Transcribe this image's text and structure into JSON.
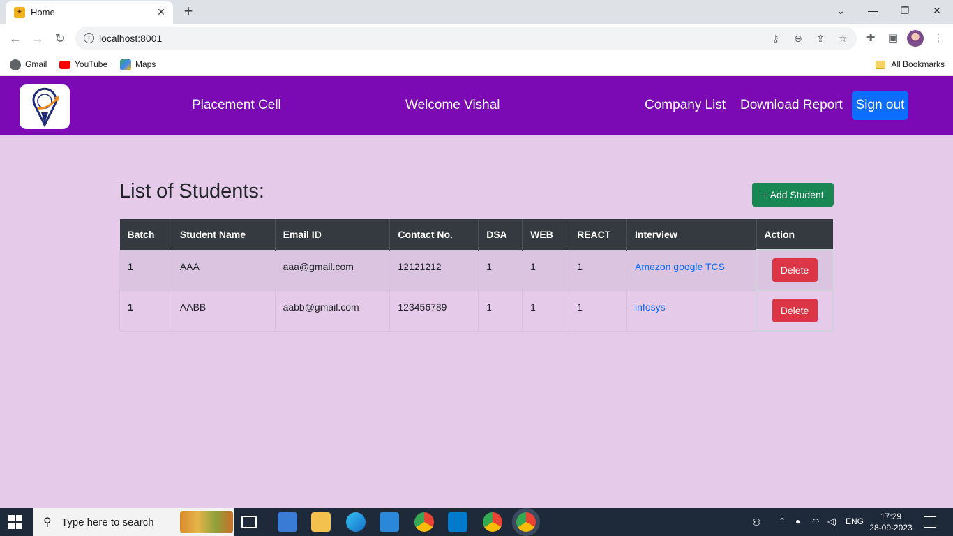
{
  "browser": {
    "tab_title": "Home",
    "tab_close": "✕",
    "new_tab": "+",
    "url": "localhost:8001",
    "bookmarks": [
      {
        "label": "Gmail",
        "icon": "gmail-icon",
        "color": "#5f6368"
      },
      {
        "label": "YouTube",
        "icon": "youtube-icon",
        "color": "#ff0000"
      },
      {
        "label": "Maps",
        "icon": "maps-icon",
        "color": "#34a853"
      }
    ],
    "all_bookmarks": "All Bookmarks"
  },
  "header": {
    "brand": "Placement Cell",
    "welcome": "Welcome Vishal",
    "company_list": "Company List",
    "download_report": "Download Report",
    "sign_out": "Sign out",
    "bg_color": "#7b0ab5"
  },
  "main": {
    "title": "List of Students:",
    "add_student": "+ Add Student",
    "columns": [
      "Batch",
      "Student Name",
      "Email ID",
      "Contact No.",
      "DSA",
      "WEB",
      "REACT",
      "Interview",
      "Action"
    ],
    "rows": [
      {
        "batch": "1",
        "name": "AAA",
        "email": "aaa@gmail.com",
        "contact": "12121212",
        "dsa": "1",
        "web": "1",
        "react": "1",
        "interview": "Amezon google TCS",
        "action": "Delete"
      },
      {
        "batch": "1",
        "name": "AABB",
        "email": "aabb@gmail.com",
        "contact": "123456789",
        "dsa": "1",
        "web": "1",
        "react": "1",
        "interview": "infosys",
        "action": "Delete"
      }
    ]
  },
  "taskbar": {
    "search_placeholder": "Type here to search",
    "language": "ENG",
    "time": "17:29",
    "date": "28-09-2023"
  }
}
